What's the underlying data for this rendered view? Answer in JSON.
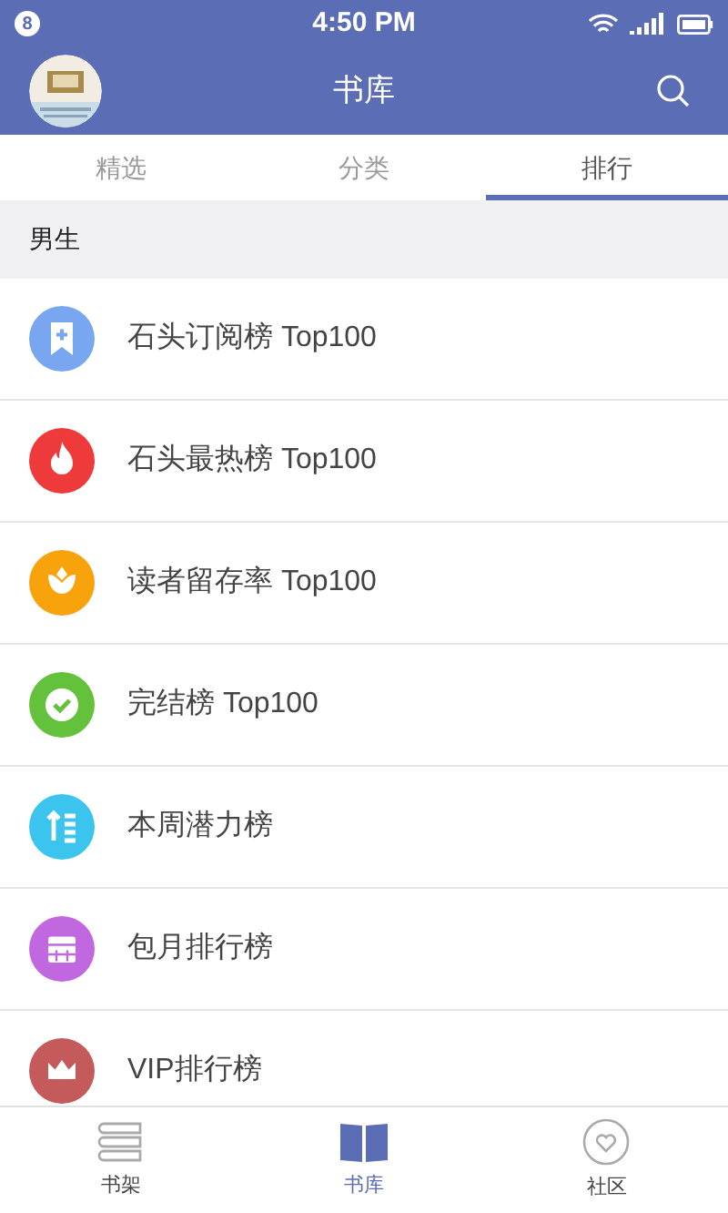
{
  "status_bar": {
    "notification_count": "8",
    "time": "4:50 PM"
  },
  "header": {
    "title": "书库"
  },
  "tabs": [
    {
      "label": "精选",
      "selected": false
    },
    {
      "label": "分类",
      "selected": false
    },
    {
      "label": "排行",
      "selected": true
    }
  ],
  "section": {
    "title": "男生"
  },
  "rankings": [
    {
      "label": "石头订阅榜 Top100",
      "kind": "bookmark",
      "color": "#78a6f0"
    },
    {
      "label": "石头最热榜 Top100",
      "kind": "fire",
      "color": "#ee3a3a"
    },
    {
      "label": "读者留存率 Top100",
      "kind": "flower",
      "color": "#f8a20c"
    },
    {
      "label": "完结榜 Top100",
      "kind": "check",
      "color": "#63c13b"
    },
    {
      "label": "本周潜力榜",
      "kind": "rising",
      "color": "#3ac4ee"
    },
    {
      "label": "包月排行榜",
      "kind": "calendar",
      "color": "#c167e0"
    },
    {
      "label": "VIP排行榜",
      "kind": "crown",
      "color": "#c45a5a"
    }
  ],
  "bottom_nav": [
    {
      "label": "书架",
      "kind": "shelf",
      "selected": false
    },
    {
      "label": "书库",
      "kind": "library",
      "selected": true
    },
    {
      "label": "社区",
      "kind": "community",
      "selected": false
    }
  ]
}
